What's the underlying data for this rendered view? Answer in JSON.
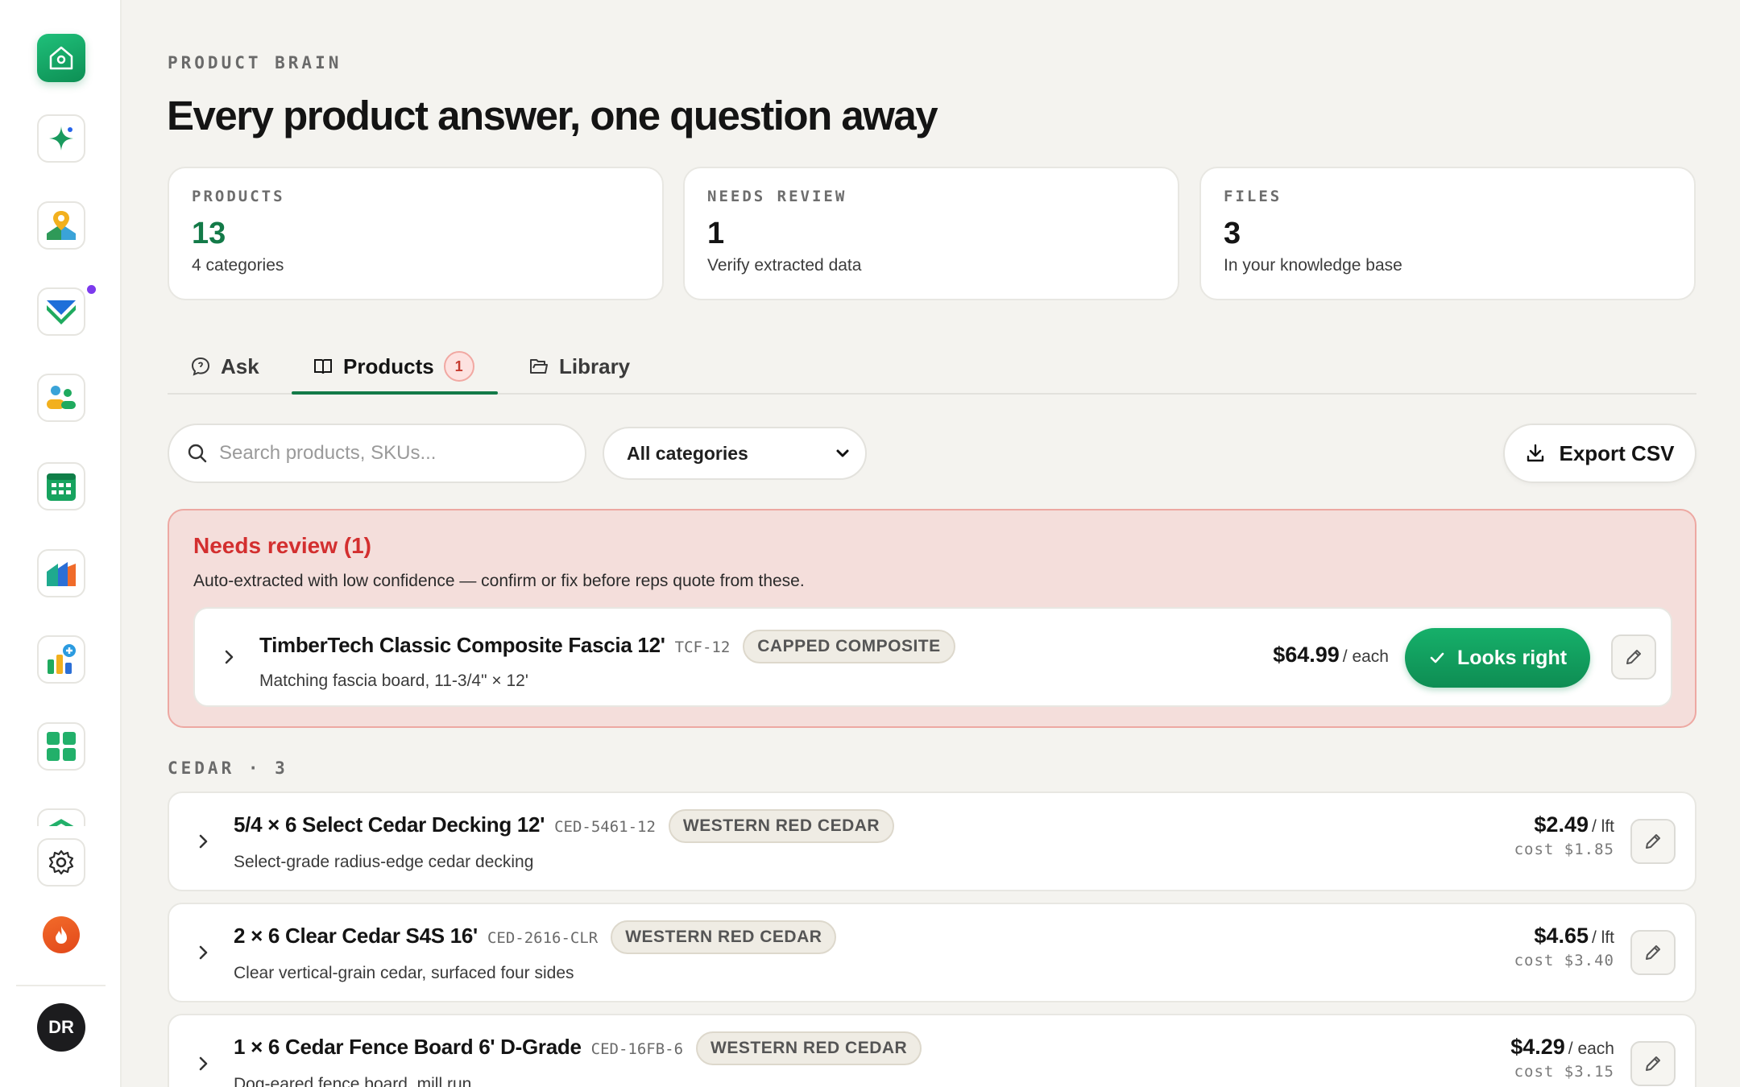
{
  "header": {
    "eyebrow": "PRODUCT BRAIN",
    "title": "Every product answer, one question away"
  },
  "stats": [
    {
      "label": "PRODUCTS",
      "value": "13",
      "sub": "4 categories",
      "accent": "#137a48"
    },
    {
      "label": "NEEDS REVIEW",
      "value": "1",
      "sub": "Verify extracted data"
    },
    {
      "label": "FILES",
      "value": "3",
      "sub": "In your knowledge base"
    }
  ],
  "tabs": [
    {
      "label": "Ask",
      "icon": "chat-bubble-icon"
    },
    {
      "label": "Products",
      "icon": "book-icon",
      "badge": "1",
      "active": true
    },
    {
      "label": "Library",
      "icon": "folder-icon"
    }
  ],
  "toolbar": {
    "search_placeholder": "Search products, SKUs...",
    "category_selected": "All categories",
    "export_label": "Export CSV"
  },
  "review": {
    "title": "Needs review (1)",
    "description": "Auto-extracted with low confidence — confirm or fix before reps quote from these.",
    "item": {
      "name": "TimberTech Classic Composite Fascia 12'",
      "sku": "TCF-12",
      "tag": "CAPPED COMPOSITE",
      "desc": "Matching fascia board, 11-3/4\" × 12'",
      "price": "$64.99",
      "unit": "/ each",
      "confirm_label": "Looks right"
    }
  },
  "section": {
    "label": "CEDAR · 3"
  },
  "products": [
    {
      "name": "5/4 × 6 Select Cedar Decking 12'",
      "sku": "CED-5461-12",
      "tag": "WESTERN RED CEDAR",
      "desc": "Select-grade radius-edge cedar decking",
      "price": "$2.49",
      "unit": "/ lft",
      "cost": "cost $1.85"
    },
    {
      "name": "2 × 6 Clear Cedar S4S 16'",
      "sku": "CED-2616-CLR",
      "tag": "WESTERN RED CEDAR",
      "desc": "Clear vertical-grain cedar, surfaced four sides",
      "price": "$4.65",
      "unit": "/ lft",
      "cost": "cost $3.40"
    },
    {
      "name": "1 × 6 Cedar Fence Board 6' D-Grade",
      "sku": "CED-16FB-6",
      "tag": "WESTERN RED CEDAR",
      "desc": "Dog-eared fence board, mill run",
      "price": "$4.29",
      "unit": "/ each",
      "cost": "cost $3.15"
    }
  ],
  "user": {
    "initials": "DR"
  },
  "colors": {
    "brand_green": "#137a48",
    "alert_red": "#d32f2f",
    "background": "#f4f3ef"
  }
}
